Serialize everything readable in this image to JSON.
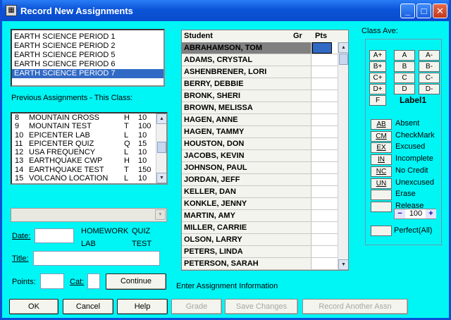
{
  "window": {
    "title": "Record New Assignments",
    "icon": "app-form-icon",
    "minimize_icon": "_",
    "maximize_icon": "□",
    "close_icon": "✕"
  },
  "classes": {
    "items": [
      "EARTH SCIENCE PERIOD 1",
      "EARTH SCIENCE PERIOD 2",
      "EARTH SCIENCE PERIOD 5",
      "EARTH SCIENCE PERIOD 6",
      "EARTH SCIENCE PERIOD 7"
    ],
    "selected_index": 4
  },
  "previous_assignments": {
    "label": "Previous Assignments - This Class:",
    "rows": [
      {
        "num": "8",
        "name": "MOUNTAIN CROSS",
        "cat": "H",
        "pts": "10"
      },
      {
        "num": "9",
        "name": "MOUNTAIN TEST",
        "cat": "T",
        "pts": "100"
      },
      {
        "num": "10",
        "name": "EPICENTER LAB",
        "cat": "L",
        "pts": "10"
      },
      {
        "num": "11",
        "name": "EPICENTER QUIZ",
        "cat": "Q",
        "pts": "15"
      },
      {
        "num": "12",
        "name": "USA FREQUENCY",
        "cat": "L",
        "pts": "10"
      },
      {
        "num": "13",
        "name": "EARTHQUAKE CWP",
        "cat": "H",
        "pts": "10"
      },
      {
        "num": "14",
        "name": "EARTHQUAKE TEST",
        "cat": "T",
        "pts": "150"
      },
      {
        "num": "15",
        "name": "VOLCANO LOCATION",
        "cat": "L",
        "pts": "10"
      }
    ]
  },
  "form": {
    "combo_value": "",
    "date_label": "Date:",
    "date_value": "",
    "category_options": [
      "HOMEWORK",
      "QUIZ",
      "LAB",
      "TEST"
    ],
    "title_label": "Title:",
    "title_value": "",
    "points_label": "Points:",
    "points_value": "",
    "cat_label": "Cat:",
    "cat_value": "",
    "continue_label": "Continue",
    "status_text": "Enter Assignment Information"
  },
  "grid": {
    "headers": {
      "student": "Student",
      "gr": "Gr",
      "pts": "Pts"
    },
    "students": [
      "ABRAHAMSON, TOM",
      "ADAMS, CRYSTAL",
      "ASHENBRENER, LORI",
      "BERRY, DEBBIE",
      "BRONK, SHERI",
      "BROWN, MELISSA",
      "HAGEN, ANNE",
      "HAGEN, TAMMY",
      "HOUSTON, DON",
      "JACOBS, KEVIN",
      "JOHNSON, PAUL",
      "JORDAN, JEFF",
      "KELLER, DAN",
      "KONKLE, JENNY",
      "MARTIN, AMY",
      "MILLER, CARRIE",
      "OLSON, LARRY",
      "PETERS, LINDA",
      "PETERSON, SARAH"
    ],
    "selected_index": 0
  },
  "grade_panel": {
    "class_ave_label": "Class Ave:",
    "grades": [
      [
        "A+",
        "A",
        "A-"
      ],
      [
        "B+",
        "B",
        "B-"
      ],
      [
        "C+",
        "C",
        "C-"
      ],
      [
        "D+",
        "D",
        "D-"
      ],
      [
        "F"
      ]
    ],
    "label1": "Label1",
    "codes": [
      {
        "code": "AB",
        "desc": "Absent"
      },
      {
        "code": "CM",
        "desc": "CheckMark"
      },
      {
        "code": "EX",
        "desc": "Excused"
      },
      {
        "code": "IN",
        "desc": "Incomplete"
      },
      {
        "code": "NC",
        "desc": "No Credit"
      },
      {
        "code": "UN",
        "desc": "Unexcused"
      },
      {
        "code": "",
        "desc": "Erase"
      },
      {
        "code": "",
        "desc": "Release"
      }
    ],
    "stepper": {
      "minus": "−",
      "value": "100",
      "plus": "+"
    },
    "perfect_label": "Perfect(All)"
  },
  "bottom_buttons": [
    {
      "label": "OK",
      "enabled": true
    },
    {
      "label": "Cancel",
      "enabled": true
    },
    {
      "label": "Help",
      "enabled": true
    },
    {
      "label": "Grade",
      "enabled": false
    },
    {
      "label": "Save Changes",
      "enabled": false
    },
    {
      "label": "Record Another Assn",
      "enabled": false
    }
  ]
}
